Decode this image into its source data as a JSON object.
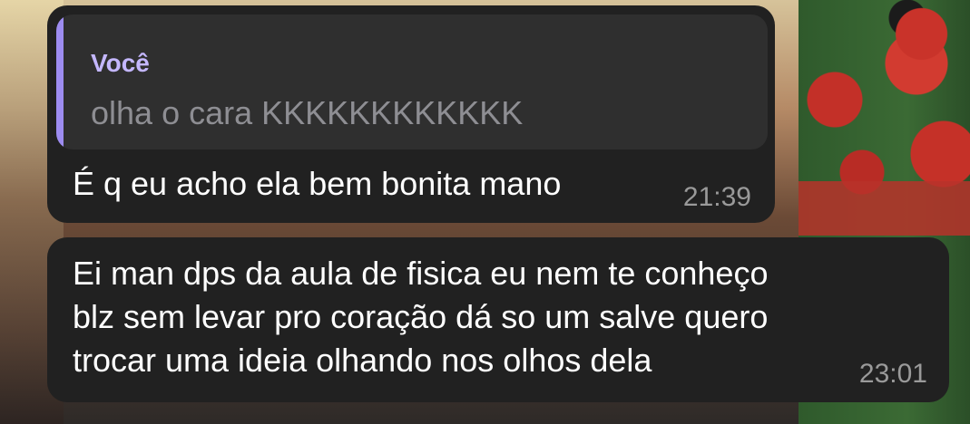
{
  "messages": [
    {
      "reply": {
        "author": "Você",
        "text": "olha o cara KKKKKKKKKKKK"
      },
      "lines": [
        "É q eu acho ela bem bonita mano"
      ],
      "time": "21:39"
    },
    {
      "lines": [
        "Ei man dps da aula de fisica eu nem te conheço",
        "blz sem levar pro coração dá so um salve quero",
        "trocar uma ideia olhando nos olhos dela"
      ],
      "time": "23:01"
    }
  ],
  "colors": {
    "bubble": "#212121",
    "reply_background": "#2f2f2f",
    "reply_accent": "#9d8cf0",
    "reply_author": "#c4b7ff",
    "reply_text": "#8e8e93",
    "timestamp": "#9a9a9a"
  }
}
